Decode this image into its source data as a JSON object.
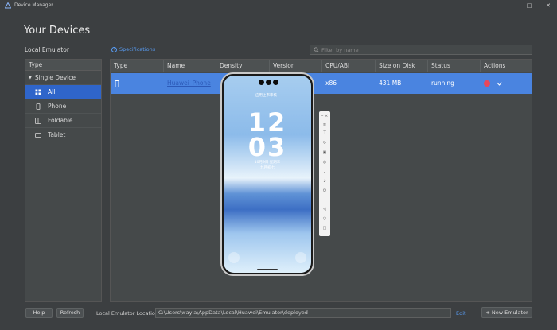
{
  "window": {
    "title": "Device Manager",
    "controls": [
      "minimize-icon",
      "restore-icon",
      "close-icon"
    ]
  },
  "header": {
    "title": "Your Devices",
    "local_emulator_label": "Local Emulator",
    "specifications_link": "Specifications",
    "filter_placeholder": "Filter by name"
  },
  "sidebar": {
    "header": "Type",
    "group_label": "Single Device",
    "items": [
      {
        "label": "All",
        "icon": "grid-icon",
        "selected": true
      },
      {
        "label": "Phone",
        "icon": "phone-icon",
        "selected": false
      },
      {
        "label": "Foldable",
        "icon": "foldable-icon",
        "selected": false
      },
      {
        "label": "Tablet",
        "icon": "tablet-icon",
        "selected": false
      }
    ]
  },
  "table": {
    "columns": [
      "Type",
      "Name",
      "Density",
      "Version",
      "CPU/ABI",
      "Size on Disk",
      "Status",
      "Actions"
    ],
    "rows": [
      {
        "type_icon": "phone-icon",
        "name": "Huawei_Phone",
        "density": "",
        "version": "",
        "cpu_abi": "x86",
        "size": "431 MB",
        "status": "running"
      }
    ]
  },
  "footer": {
    "help_label": "Help",
    "refresh_label": "Refresh",
    "location_label": "Local Emulator Location:",
    "location_value": "C:\\Users\\wayla\\AppData\\Local\\Huawei\\Emulator\\deployed",
    "edit_label": "Edit",
    "new_emulator_label": "New Emulator"
  },
  "emulator": {
    "status_text": "应用上市审核",
    "clock_hour": "12",
    "clock_minute": "03",
    "date_text": "10月9日 星期三",
    "lunar_text": "九月初七"
  },
  "colors": {
    "background": "#3c3f41",
    "selection": "#2f65ca",
    "row_selected": "#4a84e0",
    "link": "#589df6",
    "stop": "#e8475a"
  }
}
